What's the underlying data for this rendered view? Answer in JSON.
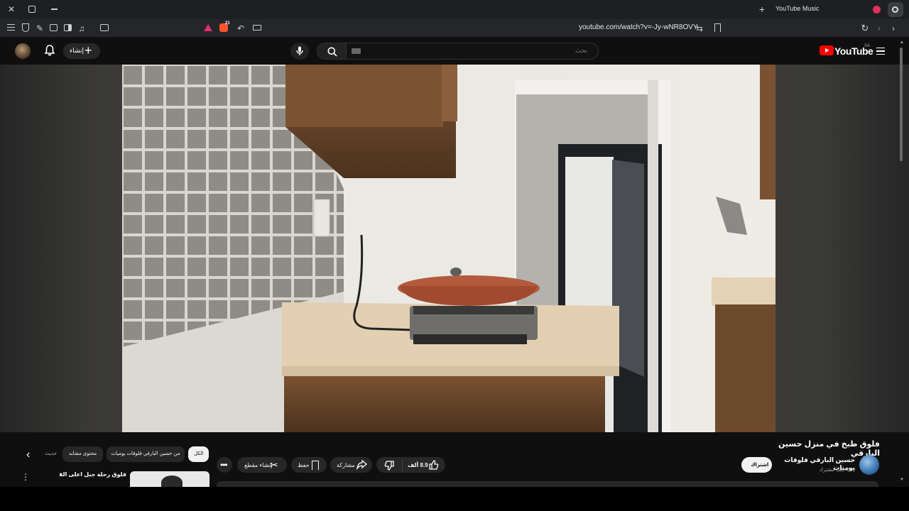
{
  "browser": {
    "tab_title": "YouTube Music",
    "url": "youtube.com/watch?v=-Jy-wNR8OVY",
    "extension_badge": "21"
  },
  "header": {
    "logo_text": "YouTube",
    "region": "SA",
    "search_placeholder": "بحث",
    "create_label": "إنشاء"
  },
  "video": {
    "title": "فلوق طبخ في منزل حسين البارقي",
    "channel_name": "حسين البارقي فلوقات يوميات",
    "subscribers": "49.9 ألف مشترك",
    "subscribe_label": "اشتراك"
  },
  "actions": {
    "like_count": "8.9 ألف",
    "share_label": "مشاركة",
    "save_label": "حفظ",
    "clip_label": "إنشاء مقطع"
  },
  "chips": [
    "الكل",
    "من حسين البارقي فلوقات يوميات",
    "محتوى مشابه",
    "حديث"
  ],
  "recommendation": {
    "title": "فلوق رحلة جبل اعلى القامة"
  },
  "colors": {
    "accent_red": "#ff0000",
    "background": "#0f0f0f"
  },
  "icons": [
    "close-icon",
    "bell-icon",
    "mic-icon",
    "search-icon",
    "menu-icon",
    "like-icon",
    "dislike-icon",
    "share-icon",
    "save-icon",
    "scissors-icon",
    "more-icon"
  ]
}
